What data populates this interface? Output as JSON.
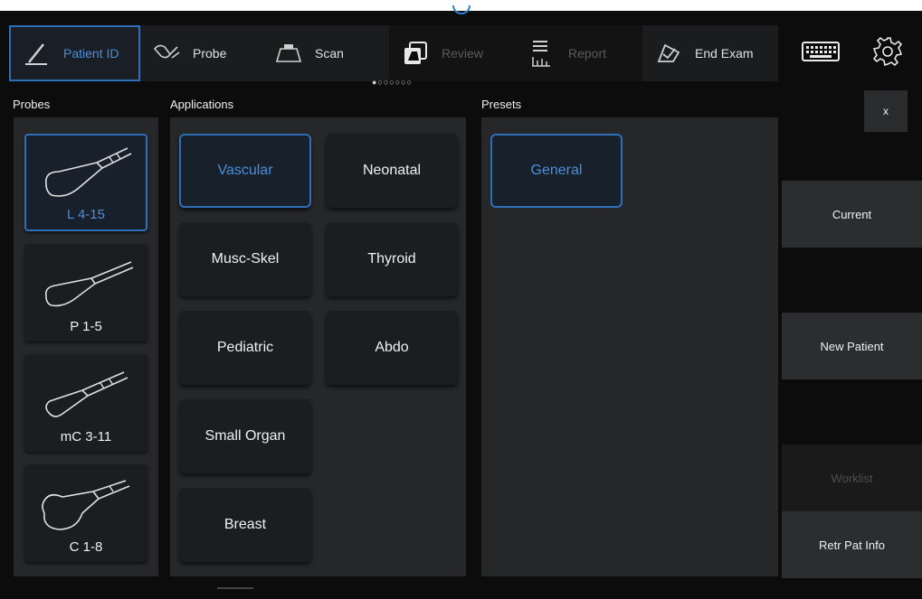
{
  "toolbar": {
    "tabs": [
      {
        "label": "Patient ID",
        "icon": "pen-icon",
        "state": "active"
      },
      {
        "label": "Probe",
        "icon": "probe-icon",
        "state": "normal"
      },
      {
        "label": "Scan",
        "icon": "scan-icon",
        "state": "normal"
      },
      {
        "label": "Review",
        "icon": "review-icon",
        "state": "disabled"
      },
      {
        "label": "Report",
        "icon": "report-icon",
        "state": "disabled"
      },
      {
        "label": "End Exam",
        "icon": "end-exam-icon",
        "state": "normal"
      }
    ],
    "page_dots": "●○○○○○○",
    "keyboard_icon": "keyboard-icon",
    "settings_icon": "gear-icon"
  },
  "probes": {
    "title": "Probes",
    "items": [
      {
        "label": "L 4-15",
        "selected": true
      },
      {
        "label": "P 1-5",
        "selected": false
      },
      {
        "label": "mC 3-11",
        "selected": false
      },
      {
        "label": "C 1-8",
        "selected": false
      }
    ]
  },
  "applications": {
    "title": "Applications",
    "items": [
      {
        "label": "Vascular",
        "selected": true
      },
      {
        "label": "Neonatal",
        "selected": false
      },
      {
        "label": "Musc-Skel",
        "selected": false
      },
      {
        "label": "Thyroid",
        "selected": false
      },
      {
        "label": "Pediatric",
        "selected": false
      },
      {
        "label": "Abdo",
        "selected": false
      },
      {
        "label": "Small Organ",
        "selected": false
      },
      {
        "label": "Breast",
        "selected": false
      }
    ]
  },
  "presets": {
    "title": "Presets",
    "items": [
      {
        "label": "General",
        "selected": true
      }
    ]
  },
  "side": {
    "close_label": "x",
    "current_label": "Current",
    "new_patient_label": "New Patient",
    "worklist_label": "Worklist",
    "retr_label": "Retr Pat Info"
  },
  "colors": {
    "accent": "#2f6fb8",
    "accent_text": "#4a8fd8",
    "panel": "#262729",
    "button": "#1c1d1f"
  }
}
